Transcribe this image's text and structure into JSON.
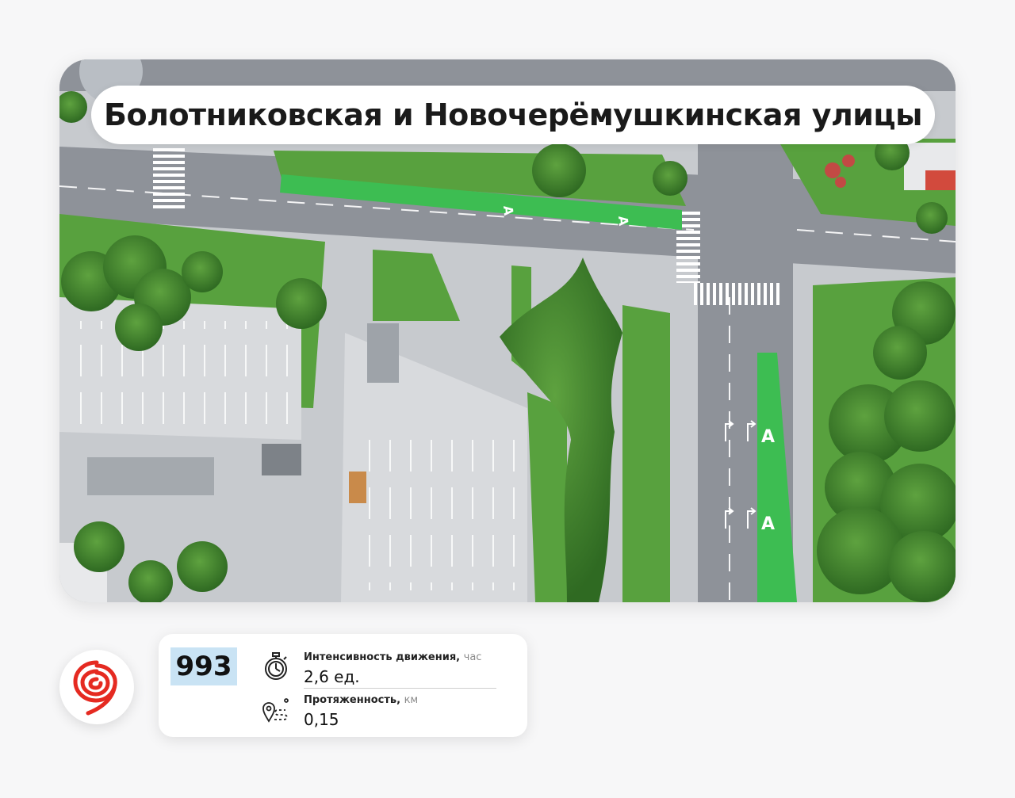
{
  "title": "Болотниковская и Новочерёмушкинская улицы",
  "route": {
    "number": "993",
    "badge_color": "#c9e3f4"
  },
  "stats": [
    {
      "icon": "stopwatch-icon",
      "label": "Интенсивность движения",
      "unit": "час",
      "value": "2,6 ед."
    },
    {
      "icon": "route-pin-icon",
      "label": "Протяженность",
      "unit": "км",
      "value": "0,15"
    }
  ],
  "logo": {
    "icon": "mosgortrans-logo-icon",
    "color": "#e52a21"
  },
  "map": {
    "lane_marking": "А",
    "colors": {
      "bus_lane": "#3dbd52",
      "grass": "#58a13e",
      "road": "#8e9299",
      "parking": "#d8dadd",
      "tree": "#3d7d2c"
    }
  }
}
